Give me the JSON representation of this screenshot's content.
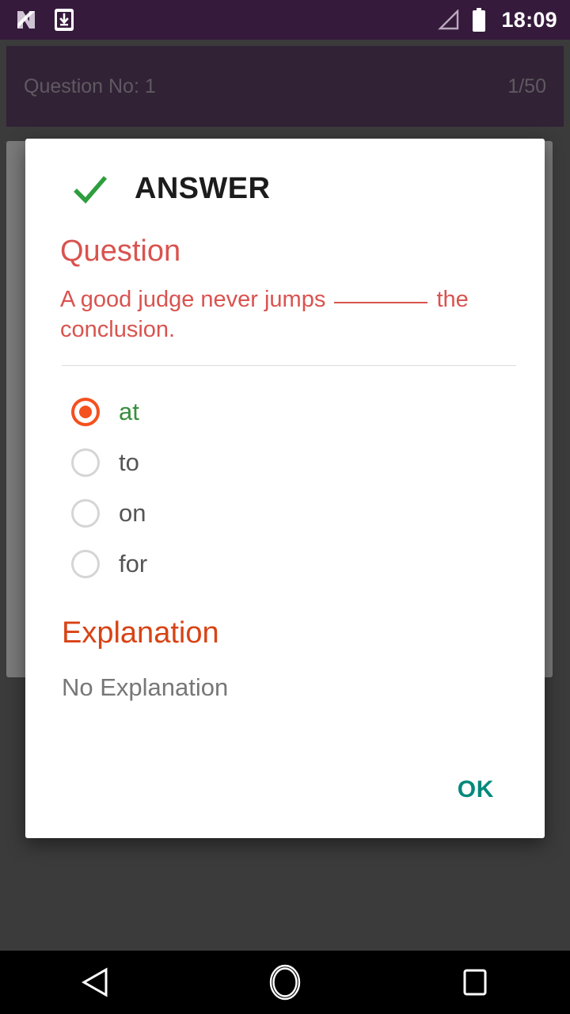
{
  "status_bar": {
    "icons_left": [
      "nougat-icon",
      "download-to-device-icon"
    ],
    "icons_right": [
      "signal-icon",
      "battery-icon"
    ],
    "clock": "18:09",
    "background_color": "#361a3c"
  },
  "question_header": {
    "label": "Question No:  1",
    "counter": "1/50",
    "background_color": "#411a4b",
    "text_color": "#b9a9bd"
  },
  "background_card": {
    "section_title": "Question",
    "question_text": "A good judge never jumps ________ the conclusion.",
    "options": [
      {
        "label": "at",
        "selected": true
      },
      {
        "label": "to",
        "selected": false
      },
      {
        "label": "on",
        "selected": false
      },
      {
        "label": "for",
        "selected": false
      }
    ]
  },
  "dialog": {
    "icon": "check-icon",
    "title": "ANSWER",
    "question_section": {
      "heading": "Question",
      "text_before_blank": "A good judge never jumps",
      "text_after_blank": "the conclusion.",
      "full_text": "A good judge never jumps ________ the conclusion.",
      "color": "#d9534f"
    },
    "options": [
      {
        "label": "at",
        "selected": true,
        "correct": true
      },
      {
        "label": "to",
        "selected": false,
        "correct": false
      },
      {
        "label": "on",
        "selected": false,
        "correct": false
      },
      {
        "label": "for",
        "selected": false,
        "correct": false
      }
    ],
    "explanation_section": {
      "heading": "Explanation",
      "text": "No Explanation",
      "heading_color": "#d84315"
    },
    "ok_label": "OK",
    "ok_color": "#00897b",
    "selected_radio_color": "#f4511e",
    "correct_option_color": "#388e3c"
  },
  "nav_bar": {
    "back_icon": "back-triangle-icon",
    "home_icon": "home-circle-icon",
    "recents_icon": "recents-square-icon"
  }
}
